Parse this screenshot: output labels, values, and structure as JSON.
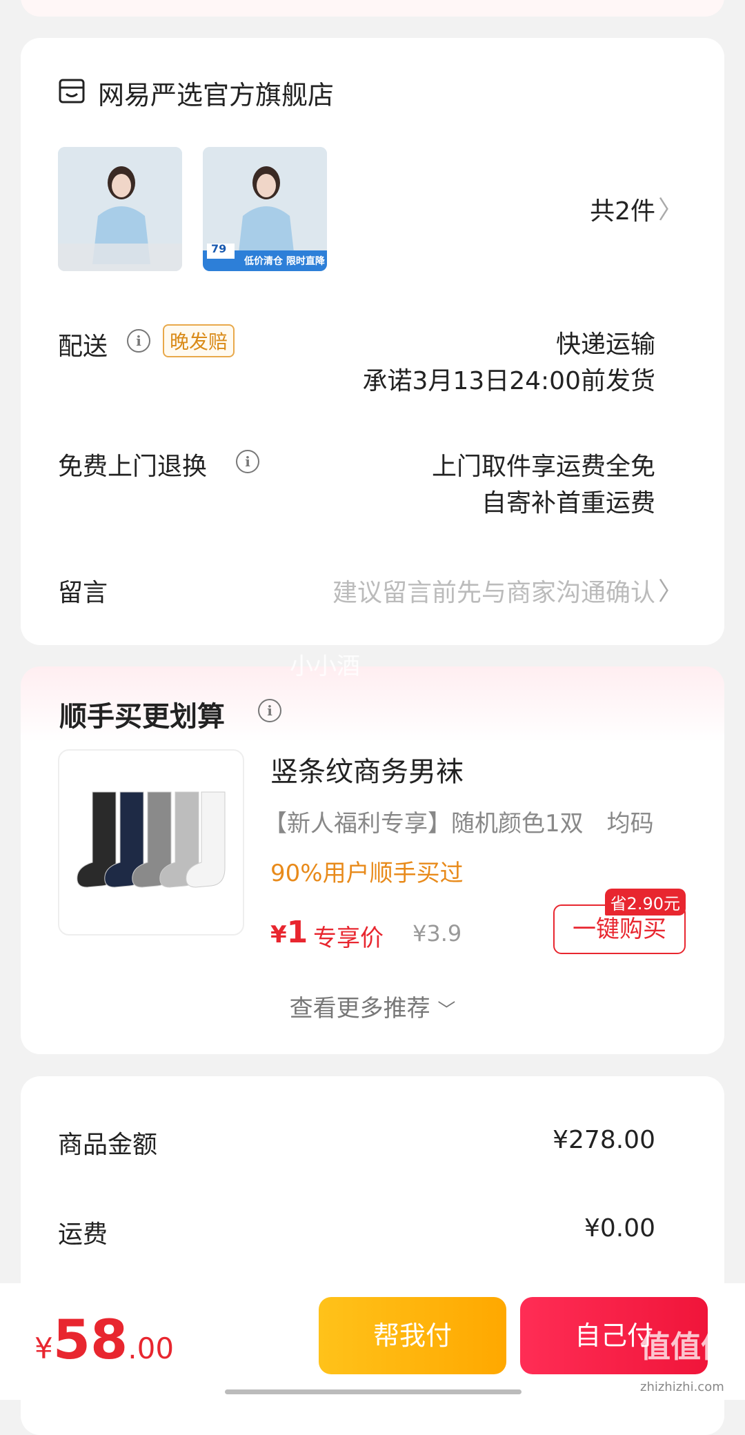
{
  "store": {
    "name": "网易严选官方旗舰店",
    "items_count": "共2件",
    "delivery": {
      "label": "配送",
      "badge": "晚发赔",
      "method": "快递运输",
      "promise": "承诺3月13日24:00前发货"
    },
    "returns": {
      "label": "免费上门退换",
      "line1": "上门取件享运费全免",
      "line2": "自寄补首重运费"
    },
    "message": {
      "label": "留言",
      "placeholder": "建议留言前先与商家沟通确认"
    },
    "thumb2": {
      "price": "79",
      "banner": "低价清仓 限时直降"
    }
  },
  "watermark_user": "小小酒",
  "upsell": {
    "title": "顺手买更划算",
    "product": {
      "name": "竖条纹商务男袜",
      "spec": "【新人福利专享】随机颜色1双　均码",
      "hint": "90%用户顺手买过",
      "price_symbol": "¥",
      "price": "1",
      "price_tag": "专享价",
      "original_price": "¥3.9",
      "save_badge": "省2.90元",
      "buy_button": "一键购买"
    },
    "more": "查看更多推荐"
  },
  "summary": {
    "goods_label": "商品金额",
    "goods_value": "¥278.00",
    "shipping_label": "运费",
    "shipping_value": "¥0.00"
  },
  "bottom": {
    "currency": "¥",
    "total_int": "58",
    "total_dec": ".00",
    "help_pay": "帮我付",
    "self_pay": "自己付"
  },
  "brand_watermark": {
    "text": "值值值",
    "url": "zhizhizhi.com"
  },
  "colors": {
    "accent_red": "#e8262f",
    "orange": "#e88a1a",
    "yellow_btn": "#ffb400"
  }
}
